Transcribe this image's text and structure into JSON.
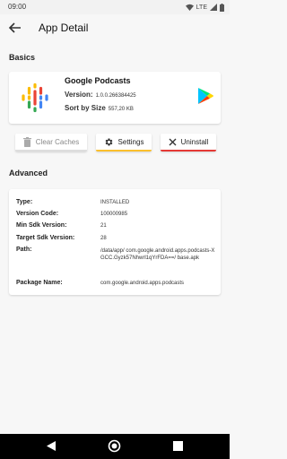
{
  "status_bar": {
    "time": "09:00",
    "network": "LTE"
  },
  "app_bar": {
    "title": "App Detail"
  },
  "basics": {
    "section_title": "Basics",
    "app_name": "Google Podcasts",
    "version_label": "Version:",
    "version_value": "1.0.0.266384425",
    "sort_label": "Sort by Size",
    "size_value": "557,20 KB"
  },
  "actions": {
    "clear_label": "Clear Caches",
    "settings_label": "Settings",
    "uninstall_label": "Uninstall"
  },
  "advanced": {
    "section_title": "Advanced",
    "rows": [
      {
        "key": "Type:",
        "value": "INSTALLED"
      },
      {
        "key": "Version Code:",
        "value": "100000985"
      },
      {
        "key": "Min Sdk Version:",
        "value": "21"
      },
      {
        "key": "Target Sdk Version:",
        "value": "28"
      },
      {
        "key": "Path:",
        "value": "/data/app/ com.google.android.apps.podcasts-XGCC.Gyzk57Nhwrl1qYrFDA==/ base.apk"
      },
      {
        "key": "Package Name:",
        "value": "com.google.android.apps.podcasts"
      }
    ]
  },
  "colors": {
    "settings_accent": "#fbc02d",
    "uninstall_accent": "#e53935"
  },
  "icons": [
    "wifi-icon",
    "signal-icon",
    "battery-icon",
    "back-arrow-icon",
    "google-podcasts-logo",
    "play-store-icon",
    "trash-icon",
    "gear-icon",
    "close-icon",
    "nav-back-icon",
    "nav-home-icon",
    "nav-recents-icon"
  ]
}
